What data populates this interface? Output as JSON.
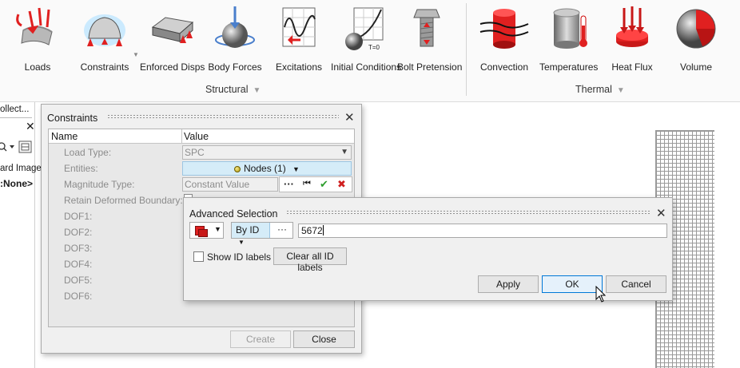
{
  "ribbon": {
    "structural": {
      "label": "Structural",
      "tools": [
        {
          "label": "Loads",
          "icon": "loads-icon"
        },
        {
          "label": "Constraints",
          "icon": "constraints-icon"
        },
        {
          "label": "Enforced Disps",
          "icon": "enforced-disps-icon"
        },
        {
          "label": "Body Forces",
          "icon": "body-forces-icon"
        },
        {
          "label": "Excitations",
          "icon": "excitations-icon"
        },
        {
          "label": "Initial Conditions",
          "icon": "initial-conditions-icon",
          "icon_text": "T=0"
        },
        {
          "label": "Bolt Pretension",
          "icon": "bolt-pretension-icon"
        }
      ]
    },
    "thermal": {
      "label": "Thermal",
      "tools": [
        {
          "label": "Convection",
          "icon": "convection-icon"
        },
        {
          "label": "Temperatures",
          "icon": "temperatures-icon"
        },
        {
          "label": "Heat Flux",
          "icon": "heat-flux-icon"
        },
        {
          "label": "Volume",
          "icon": "volume-icon"
        }
      ]
    }
  },
  "left_panel": {
    "tab_label": "ollect...",
    "line1": "ard Image",
    "line2": ":None>"
  },
  "constraints_dialog": {
    "title": "Constraints",
    "columns": [
      "Name",
      "Value"
    ],
    "rows": [
      {
        "name": "Load Type:",
        "value": "SPC"
      },
      {
        "name": "Entities:",
        "value": "Nodes (1)"
      },
      {
        "name": "Magnitude Type:",
        "value": "Constant Value"
      },
      {
        "name": "Retain Deformed Boundary:",
        "value": ""
      },
      {
        "name": "DOF1:",
        "value": ""
      },
      {
        "name": "DOF2:",
        "value": ""
      },
      {
        "name": "DOF3:",
        "value": ""
      },
      {
        "name": "DOF4:",
        "value": ""
      },
      {
        "name": "DOF5:",
        "value": ""
      },
      {
        "name": "DOF6:",
        "value": ""
      }
    ],
    "mini_toolbar": {
      "more": "···",
      "reset": "⏮",
      "apply": "✔",
      "cancel": "✖"
    },
    "create_label": "Create",
    "close_label": "Close"
  },
  "advanced_selection": {
    "title": "Advanced Selection",
    "mode": "By ID",
    "more": "···",
    "id_value": "5672",
    "show_id_labels": "Show ID labels",
    "show_id_labels_checked": false,
    "clear_label": "Clear all ID labels",
    "apply_label": "Apply",
    "ok_label": "OK",
    "cancel_label": "Cancel"
  },
  "colors": {
    "accent": "#0078d7",
    "selection_fill": "#d5ecf8",
    "red_icon": "#e02020"
  }
}
